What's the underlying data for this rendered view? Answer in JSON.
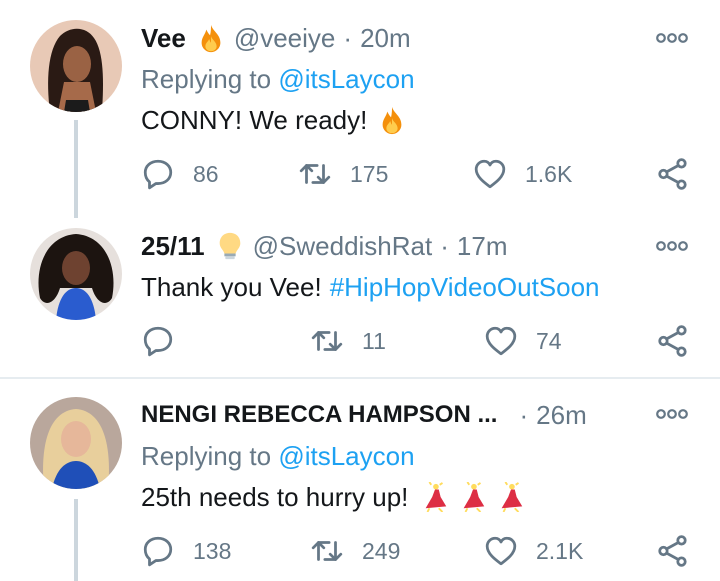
{
  "tweets": [
    {
      "name": "Vee",
      "name_emoji": "fire-icon",
      "handle": "@veeiye",
      "separator": "·",
      "time": "20m",
      "replying_prefix": "Replying to",
      "replying_to": "@itsLaycon",
      "text": "CONNY! We ready!",
      "text_emoji": "fire-icon",
      "replies": "86",
      "retweets": "175",
      "likes": "1.6K"
    },
    {
      "name": "25/11",
      "name_emoji": "lightbulb-icon",
      "handle": "@SweddishRat",
      "separator": "·",
      "time": "17m",
      "text": "Thank you Vee!",
      "hashtag": "#HipHopVideoOutSoon",
      "replies": "",
      "retweets": "11",
      "likes": "74"
    },
    {
      "name": "NENGI REBECCA HAMPSON ...",
      "handle": "",
      "separator": "·",
      "time": "26m",
      "replying_prefix": "Replying to",
      "replying_to": "@itsLaycon",
      "text": "25th needs to hurry up!",
      "text_emoji": "dancer-icon",
      "replies": "138",
      "retweets": "249",
      "likes": "2.1K"
    }
  ],
  "colors": {
    "link": "#1da1f2",
    "secondary_text": "#657786",
    "primary_text": "#14171a",
    "thread_line": "#ccd6dd",
    "divider": "#e6ecf0"
  }
}
